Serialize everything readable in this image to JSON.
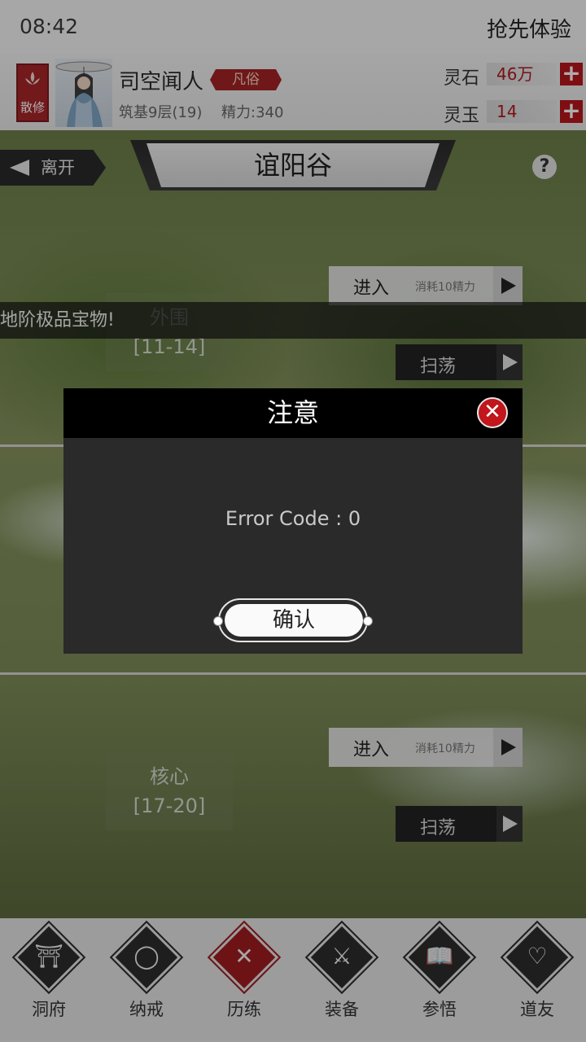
{
  "status_bar": {
    "time": "08:42",
    "top_right": "抢先体验"
  },
  "player": {
    "sect": "散修",
    "name": "司空闻人",
    "rank": "凡俗",
    "level": "筑基9层(19)",
    "energy": "精力:340"
  },
  "resources": [
    {
      "label": "灵石",
      "value": "46万"
    },
    {
      "label": "灵玉",
      "value": "14"
    }
  ],
  "titlebar": {
    "leave": "离开",
    "title": "谊阳谷",
    "help": "?"
  },
  "stages": [
    {
      "name": "外围",
      "range": "[11-14]",
      "enter": "进入",
      "cost": "消耗10精力",
      "sweep": "扫荡"
    },
    {
      "name": "核心",
      "range": "[17-20]",
      "enter": "进入",
      "cost": "消耗10精力",
      "sweep": "扫荡"
    }
  ],
  "marquee": "地阶极品宝物!",
  "modal": {
    "title": "注意",
    "message": "Error Code : 0",
    "confirm": "确认"
  },
  "nav": [
    {
      "label": "洞府",
      "icon": "gate-icon",
      "glyph": "⛩"
    },
    {
      "label": "纳戒",
      "icon": "ring-icon",
      "glyph": "◯"
    },
    {
      "label": "历练",
      "icon": "crossed-swords-icon",
      "glyph": "✕"
    },
    {
      "label": "装备",
      "icon": "dagger-icon",
      "glyph": "⚔"
    },
    {
      "label": "参悟",
      "icon": "book-icon",
      "glyph": "📖"
    },
    {
      "label": "道友",
      "icon": "handshake-icon",
      "glyph": "♡"
    }
  ],
  "colors": {
    "accent_red": "#a8262a",
    "modal_bg": "#2a2a2a"
  }
}
